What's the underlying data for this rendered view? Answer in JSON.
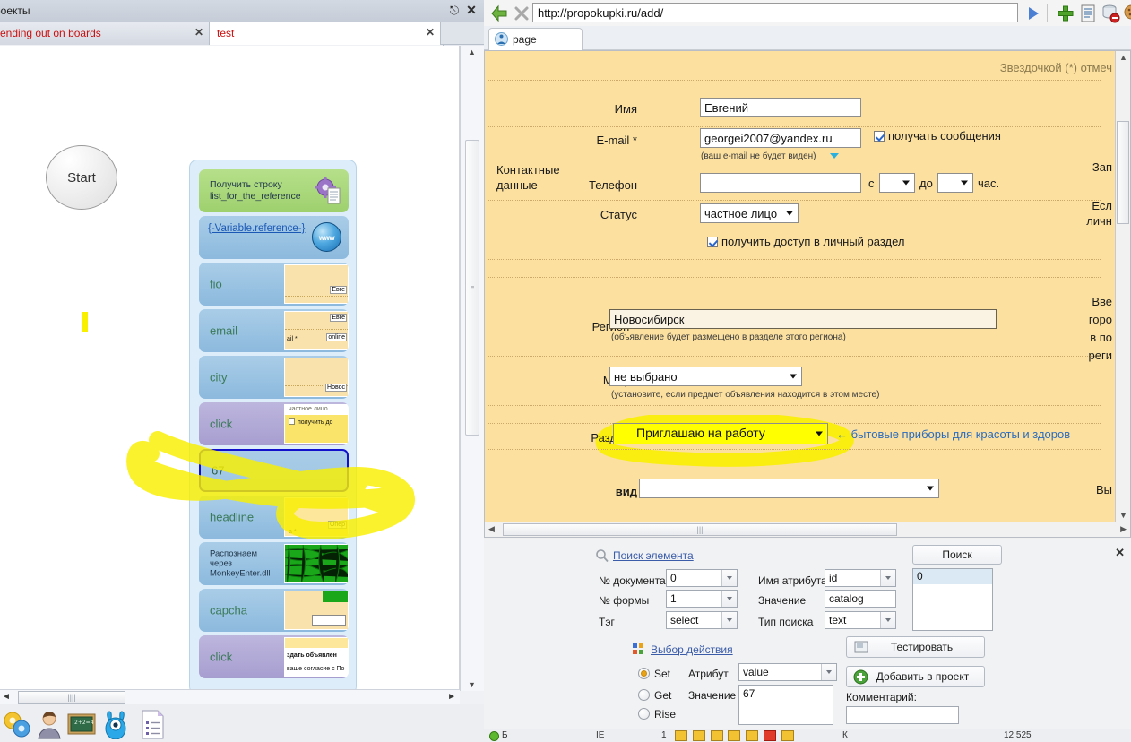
{
  "left_panel": {
    "title": "роекты",
    "pin_icon": "pin-icon",
    "close_icon": "close-icon",
    "tabs": [
      {
        "label": "sending out on boards",
        "close": "✕"
      },
      {
        "label": "test",
        "close": "✕"
      }
    ],
    "tab_nav": {
      "prev": "◄",
      "next": "►"
    },
    "start_node": {
      "label": "Start"
    },
    "blocks": [
      {
        "label": "Получить строку\nlist_for_the_reference",
        "type": "green",
        "icon": "gear-document-icon"
      },
      {
        "label": "{-Variable.reference-}",
        "type": "link",
        "icon": "www-globe-icon"
      },
      {
        "label": "fio",
        "type": "blue",
        "thumb_texts": [
          "Евге"
        ]
      },
      {
        "label": "email",
        "type": "blue",
        "thumb_texts": [
          "Евге",
          "online",
          "ail *"
        ]
      },
      {
        "label": "city",
        "type": "blue",
        "thumb_texts": [
          "Новос"
        ]
      },
      {
        "label": "click",
        "type": "purple",
        "thumb_texts": [
          "частное лицо",
          "получить до"
        ]
      },
      {
        "label": "67",
        "type": "selected",
        "thumb_texts": []
      },
      {
        "label": "headline",
        "type": "blue",
        "thumb_texts": [
          "Опер",
          "а *"
        ]
      },
      {
        "label": "Распознаем\nчерез\nMonkeyEnter.dll",
        "type": "blue",
        "thumb_texts": []
      },
      {
        "label": "capcha",
        "type": "blue",
        "thumb_texts": []
      },
      {
        "label": "click",
        "type": "purple",
        "thumb_texts": [
          "здать объявлен",
          "ваше согласие с По"
        ]
      }
    ],
    "hscroll": {
      "grip": "||||",
      "left": "◄",
      "right": "►"
    },
    "vscroll": {
      "up": "▲",
      "down": "▼",
      "grip": "≡"
    },
    "taskbar_icons": [
      "gears-icon",
      "user-icon",
      "blackboard-icon",
      "monster-icon",
      "list-document-icon"
    ]
  },
  "browser": {
    "back_icon": "back-arrow-icon",
    "stop_icon": "stop-x-icon",
    "address": "http://propokupki.ru/add/",
    "go_icon": "go-play-icon",
    "add_icon": "plus-add-icon",
    "source_icon": "page-source-icon",
    "clear_cache_icon": "clear-cache-icon",
    "clear_cookies_icon": "clear-cookies-icon",
    "tab": {
      "label": "page",
      "favicon": "page-favicon"
    }
  },
  "page": {
    "note_top": "Звездочкой (*) отмеч",
    "section_contact": "Контактные\nданные",
    "fields": {
      "name_label": "Имя",
      "name_value": "Евгений",
      "email_label": "E-mail *",
      "email_value": "georgei2007@yandex.ru",
      "email_hint": "(ваш e-mail не будет виден)",
      "email_checkbox_label": "получать сообщения",
      "phone_label": "Телефон",
      "phone_value": "",
      "phone_from": "с",
      "phone_to": "до",
      "phone_unit": "час.",
      "status_label": "Статус",
      "status_value": "частное лицо",
      "access_checkbox_label": "получить доступ в личный раздел",
      "region_label": "Регион *",
      "region_value": "Новосибирск",
      "region_hint": "(объявление будет размещено в разделе этого региона)",
      "metro_label": "Метро",
      "metro_value": "не выбрано",
      "metro_hint": "(установите, если предмет объявления находится в этом месте)",
      "section_label": "Раздел *",
      "section_value": "Приглашаю на работу",
      "section_link": "← бытовые приборы для красоты и здоров",
      "kind_label": "вид",
      "kind_value": ""
    },
    "right_notes": [
      "Зап",
      "Есл",
      "личн",
      "Вве",
      "горо",
      "в по",
      "реги",
      "здоров",
      "Вы"
    ],
    "hscroll_grip": "|||"
  },
  "tool_panel": {
    "search_element_link": "Поиск элемента",
    "search_icon": "magnifier-icon",
    "search_button": "Поиск",
    "close_icon": "close-icon",
    "doc_num_label": "№ документа",
    "doc_num_value": "0",
    "form_num_label": "№ формы",
    "form_num_value": "1",
    "tag_label": "Тэг",
    "tag_value": "select",
    "attr_name_label": "Имя атрибута",
    "attr_name_value": "id",
    "attr_value_label": "Значение",
    "attr_value_value": "catalog",
    "search_type_label": "Тип поиска",
    "search_type_value": "text",
    "results": [
      "0"
    ],
    "action_link": "Выбор действия",
    "action_icon": "action-grid-icon",
    "test_button": "Тестировать",
    "test_icon": "test-icon",
    "add_project_button": "Добавить в проект",
    "add_project_icon": "add-circle-icon",
    "radios": [
      {
        "label": "Set",
        "selected": true
      },
      {
        "label": "Get",
        "selected": false
      },
      {
        "label": "Rise",
        "selected": false
      }
    ],
    "attribute_label": "Атрибут",
    "attribute_value": "value",
    "value_label": "Значение",
    "value_value": "67",
    "comment_label": "Комментарий:",
    "comment_value": ""
  },
  "status_bar": {
    "state": "Б",
    "count_label": "IE",
    "count_value": "1",
    "memory_label": "К",
    "memory_value": "12 525"
  },
  "colors": {
    "page_bg": "#fbe0a0",
    "highlight": "#f9f000",
    "block_green": "#a9d87c",
    "block_blue": "#9cc5e4",
    "block_purple": "#b0a8d6",
    "selection_border": "#1111cc",
    "link": "#2a6bbd"
  }
}
